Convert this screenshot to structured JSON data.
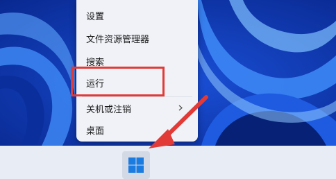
{
  "context_menu": {
    "items": [
      {
        "label": "设置"
      },
      {
        "label": "文件资源管理器"
      },
      {
        "label": "搜索"
      },
      {
        "label": "运行"
      },
      {
        "label": "关机或注销",
        "has_submenu": true
      },
      {
        "label": "桌面"
      }
    ]
  },
  "highlight": {
    "target": "运行",
    "color": "#e23a37"
  },
  "taskbar": {
    "start_button_icon": "windows-logo-icon",
    "color": "#e8ecf4"
  },
  "annotation_arrow": {
    "color": "#e23a37",
    "points_to": "start-button"
  },
  "colors": {
    "wallpaper": "#0d3fc0",
    "menu_background": "#f0f2f7"
  }
}
